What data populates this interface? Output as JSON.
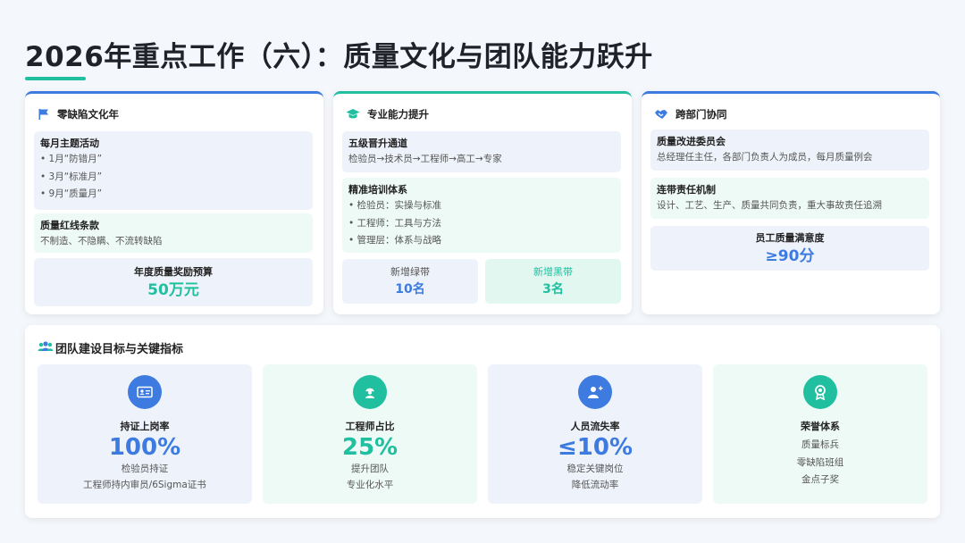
{
  "title": "2026年重点工作（六）：质量文化与团队能力跃升",
  "colors": {
    "blue": "#3d7be0",
    "green": "#1fbf9f",
    "blue_bg": "#eef3fb",
    "green_bg": "#eefaf6"
  },
  "card1": {
    "icon": "flag-icon",
    "title": "零缺陷文化年",
    "monthly": {
      "title": "每月主题活动",
      "items": [
        "• 1月“防错月”",
        "• 3月“标准月”",
        "• 9月“质量月”"
      ]
    },
    "redline": {
      "title": "质量红线条款",
      "text": "不制造、不隐瞒、不流转缺陷"
    },
    "budget": {
      "label": "年度质量奖励预算",
      "value": "50万元"
    }
  },
  "card2": {
    "icon": "graduation-cap-icon",
    "title": "专业能力提升",
    "path": {
      "title": "五级晋升通道",
      "text": "检验员→技术员→工程师→高工→专家"
    },
    "training": {
      "title": "精准培训体系",
      "items": [
        "• 检验员：实操与标准",
        "• 工程师：工具与方法",
        "• 管理层：体系与战略"
      ]
    },
    "green_belt": {
      "label": "新增绿带",
      "value": "10名"
    },
    "black_belt": {
      "label": "新增黑带",
      "value": "3名"
    }
  },
  "card3": {
    "icon": "handshake-icon",
    "title": "跨部门协同",
    "committee": {
      "title": "质量改进委员会",
      "text": "总经理任主任，各部门负责人为成员，每月质量例会"
    },
    "liability": {
      "title": "连带责任机制",
      "text": "设计、工艺、生产、质量共同负责，重大事故责任追溯"
    },
    "satisfaction": {
      "label": "员工质量满意度",
      "value": "≥90分"
    }
  },
  "bottom": {
    "icon": "users-icon",
    "title": "团队建设目标与关键指标",
    "metrics": [
      {
        "icon": "id-card-icon",
        "label": "持证上岗率",
        "value": "100%",
        "desc": [
          "检验员持证",
          "工程师持内审员/6Sigma证书"
        ]
      },
      {
        "icon": "engineer-icon",
        "label": "工程师占比",
        "value": "25%",
        "desc": [
          "提升团队",
          "专业化水平"
        ]
      },
      {
        "icon": "user-plus-icon",
        "label": "人员流失率",
        "value": "≤10%",
        "desc": [
          "稳定关键岗位",
          "降低流动率"
        ]
      },
      {
        "icon": "award-icon",
        "label": "荣誉体系",
        "items": [
          "质量标兵",
          "零缺陷班组",
          "金点子奖"
        ]
      }
    ]
  }
}
